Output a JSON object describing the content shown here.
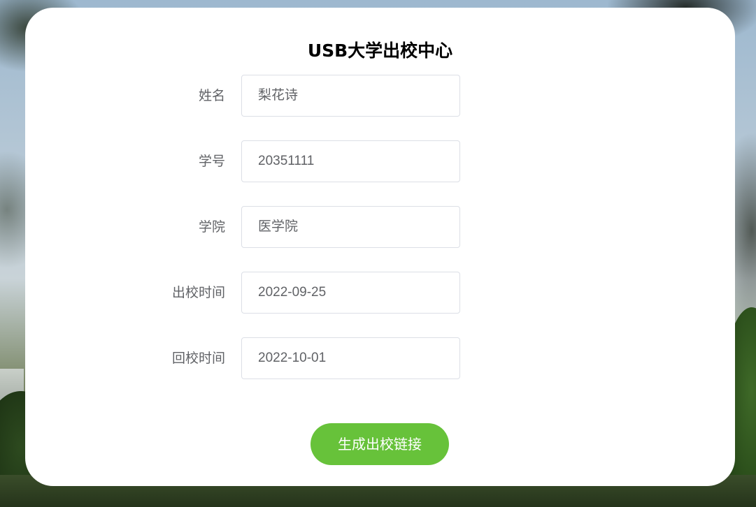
{
  "page": {
    "title": "USB大学出校中心"
  },
  "form": {
    "fields": [
      {
        "label": "姓名",
        "value": "梨花诗"
      },
      {
        "label": "学号",
        "value": "20351111"
      },
      {
        "label": "学院",
        "value": "医学院"
      },
      {
        "label": "出校时间",
        "value": "2022-09-25"
      },
      {
        "label": "回校时间",
        "value": "2022-10-01"
      }
    ],
    "submit_label": "生成出校链接"
  },
  "colors": {
    "button_bg": "#67c23a",
    "label_text": "#606266",
    "input_border": "#dcdfe6"
  }
}
